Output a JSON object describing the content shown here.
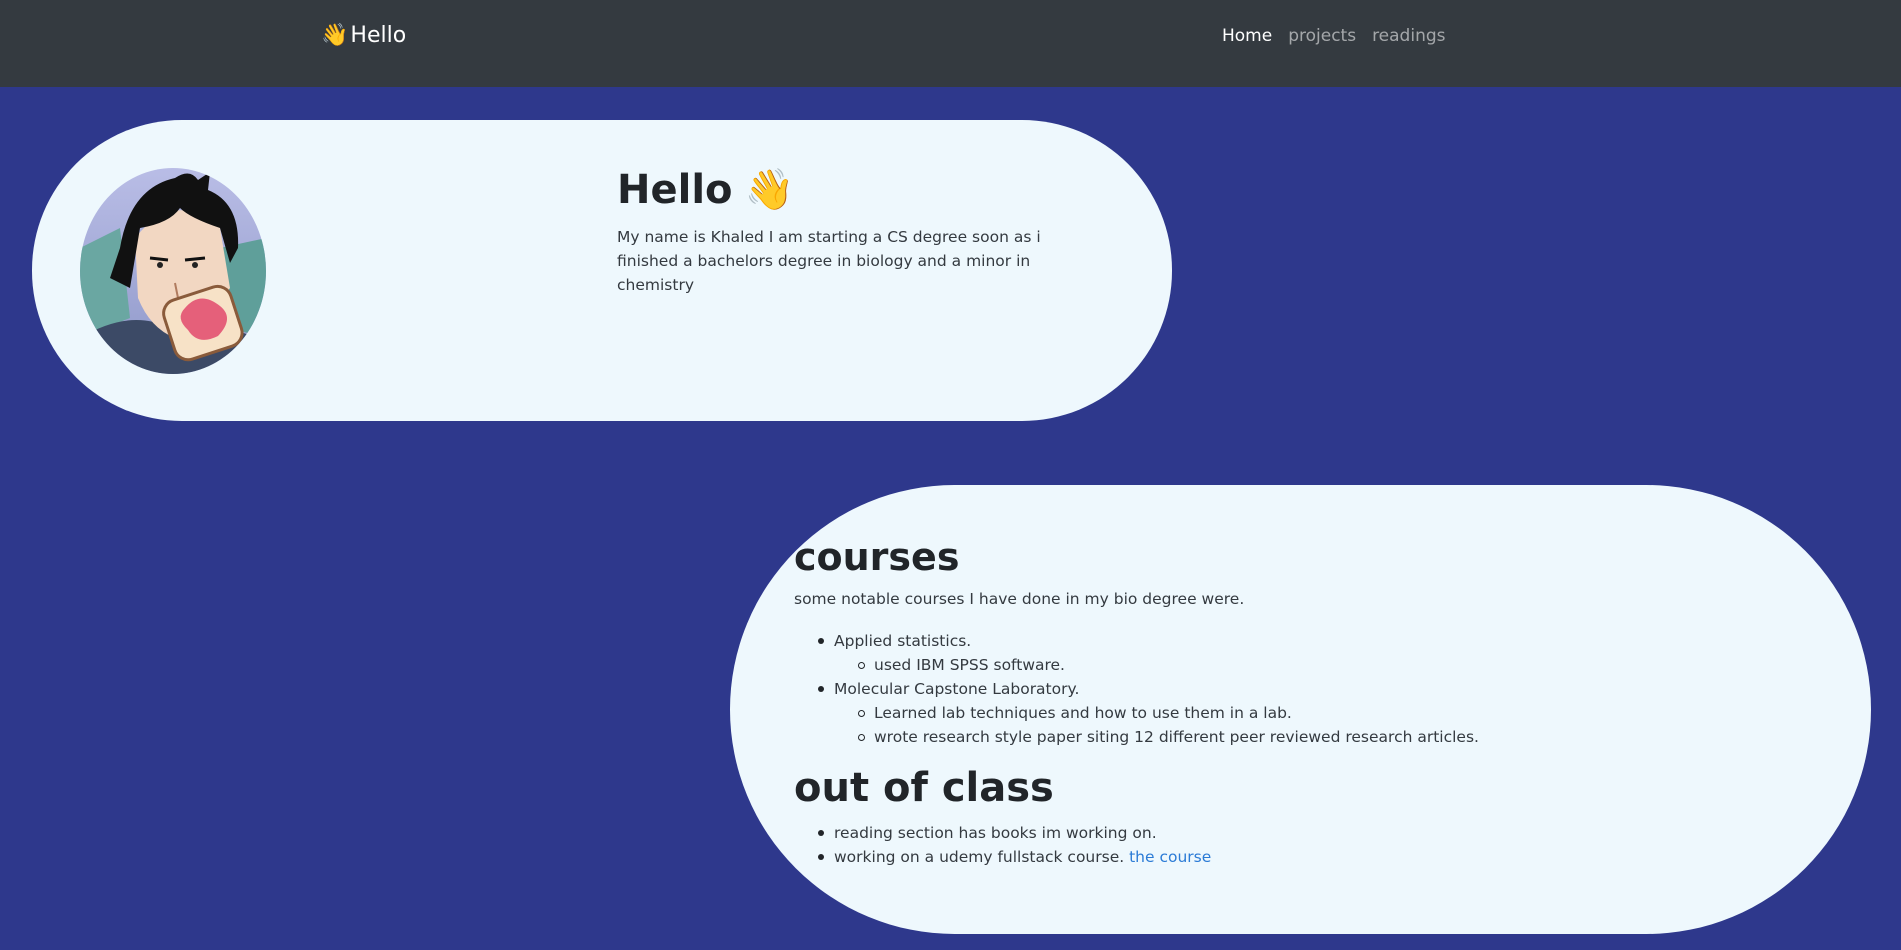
{
  "navbar": {
    "brand_emoji": "👋",
    "brand_text": "Hello",
    "links": [
      "Home",
      "projects",
      "readings"
    ],
    "active": "Home"
  },
  "hello_card": {
    "title": "Hello",
    "title_emoji": "👋",
    "text": "My name is Khaled I am starting a CS degree soon as i finished a bachelors degree in biology and a minor in chemistry"
  },
  "courses_card": {
    "courses_heading": "courses",
    "courses_intro": "some notable courses I have done in my bio degree were.",
    "courses": [
      {
        "label": "Applied statistics.",
        "sub": [
          "used IBM SPSS software."
        ]
      },
      {
        "label": "Molecular Capstone Laboratory.",
        "sub": [
          "Learned lab techniques and how to use them in a lab.",
          "wrote research style paper siting 12 different peer reviewed research articles."
        ]
      }
    ],
    "out_heading": "out of class",
    "out_items": [
      "reading section has books im working on.",
      "working on a udemy fullstack course."
    ],
    "course_link": "the course"
  },
  "colors": {
    "page_bg": "#2e388c",
    "navbar_bg": "#343a40",
    "card_bg": "#eef8fd",
    "link": "#2b7bd6"
  },
  "icons": [
    "waving-hand-icon",
    "avatar-illustration"
  ]
}
